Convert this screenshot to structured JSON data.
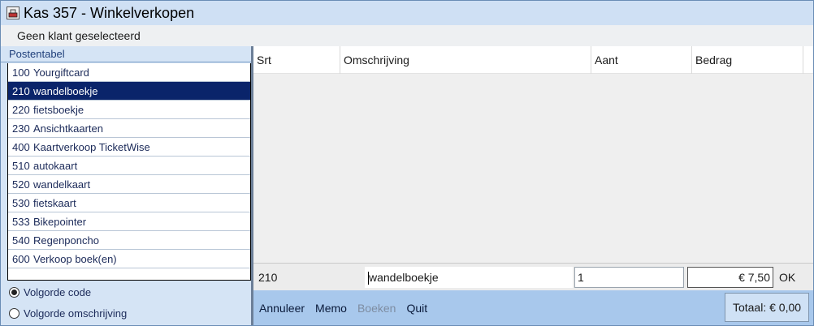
{
  "window": {
    "title": "Kas 357 - Winkelverkopen",
    "icon": "cash-register-icon"
  },
  "customer": {
    "status": "Geen klant geselecteerd"
  },
  "postentabel": {
    "header": "Postentabel",
    "items": [
      {
        "code": "100",
        "label": "Yourgiftcard",
        "selected": false
      },
      {
        "code": "210",
        "label": "wandelboekje",
        "selected": true
      },
      {
        "code": "220",
        "label": "fietsboekje",
        "selected": false
      },
      {
        "code": "230",
        "label": "Ansichtkaarten",
        "selected": false
      },
      {
        "code": "400",
        "label": "Kaartverkoop TicketWise",
        "selected": false
      },
      {
        "code": "510",
        "label": "autokaart",
        "selected": false
      },
      {
        "code": "520",
        "label": "wandelkaart",
        "selected": false
      },
      {
        "code": "530",
        "label": "fietskaart",
        "selected": false
      },
      {
        "code": "533",
        "label": "Bikepointer",
        "selected": false
      },
      {
        "code": "540",
        "label": "Regenponcho",
        "selected": false
      },
      {
        "code": "600",
        "label": "Verkoop boek(en)",
        "selected": false
      }
    ],
    "sort_options": [
      {
        "label": "Volgorde code",
        "checked": true
      },
      {
        "label": "Volgorde omschrijving",
        "checked": false
      }
    ]
  },
  "grid": {
    "columns": [
      "Srt",
      "Omschrijving",
      "Aant",
      "Bedrag"
    ]
  },
  "entry": {
    "code": "210",
    "description": "wandelboekje",
    "quantity": "1",
    "amount": "€ 7,50",
    "ok_label": "OK"
  },
  "actions": {
    "annuleer": "Annuleer",
    "memo": "Memo",
    "boeken": "Boeken",
    "quit": "Quit"
  },
  "total": {
    "label": "Totaal: € 0,00"
  },
  "colors": {
    "selection": "#0a246a",
    "action_bar": "#a8c8ec",
    "panel": "#d5e4f5"
  }
}
